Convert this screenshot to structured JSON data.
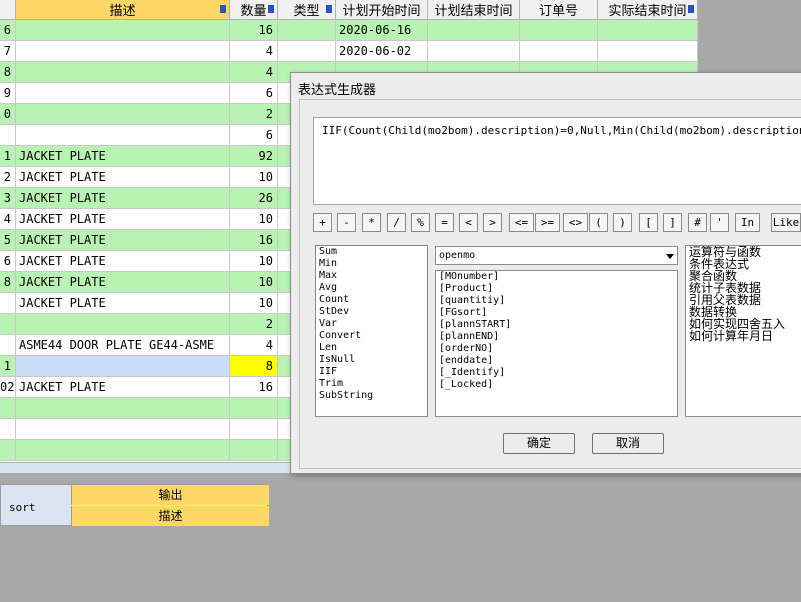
{
  "grid": {
    "headers": [
      "",
      "描述",
      "数量",
      "类型",
      "计划开始时间",
      "计划结束时间",
      "订单号",
      "实际结束时间"
    ],
    "rows": [
      {
        "id": "6",
        "desc": "",
        "qty": "16",
        "date": "2020-06-16"
      },
      {
        "id": "7",
        "desc": "",
        "qty": "4",
        "date": "2020-06-02"
      },
      {
        "id": "8",
        "desc": "",
        "qty": "4",
        "date": ""
      },
      {
        "id": "9",
        "desc": "",
        "qty": "6",
        "date": ""
      },
      {
        "id": "0",
        "desc": "",
        "qty": "2",
        "date": ""
      },
      {
        "id": "",
        "desc": "",
        "qty": "6",
        "date": ""
      },
      {
        "id": "1",
        "desc": "JACKET PLATE",
        "qty": "92",
        "date": ""
      },
      {
        "id": "2",
        "desc": "JACKET PLATE",
        "qty": "10",
        "date": ""
      },
      {
        "id": "3",
        "desc": "JACKET PLATE",
        "qty": "26",
        "date": ""
      },
      {
        "id": "4",
        "desc": "JACKET PLATE",
        "qty": "10",
        "date": ""
      },
      {
        "id": "5",
        "desc": "JACKET PLATE",
        "qty": "16",
        "date": ""
      },
      {
        "id": "6",
        "desc": "JACKET PLATE",
        "qty": "10",
        "date": ""
      },
      {
        "id": "8",
        "desc": "JACKET PLATE",
        "qty": "10",
        "date": ""
      },
      {
        "id": "",
        "desc": "JACKET PLATE",
        "qty": "10",
        "date": ""
      },
      {
        "id": "",
        "desc": "",
        "qty": "2",
        "date": ""
      },
      {
        "id": "",
        "desc": "ASME44 DOOR PLATE GE44-ASME",
        "qty": "4",
        "date": ""
      },
      {
        "id": "1",
        "desc": "",
        "qty": "8",
        "date": ""
      },
      {
        "id": "02",
        "desc": "JACKET PLATE",
        "qty": "16",
        "date": ""
      },
      {
        "id": "",
        "desc": "",
        "qty": "",
        "date": ""
      },
      {
        "id": "",
        "desc": "",
        "qty": "",
        "date": ""
      },
      {
        "id": "",
        "desc": "",
        "qty": "",
        "date": ""
      }
    ]
  },
  "subgrid": {
    "label": "sort",
    "row1": "输出",
    "row2": "描述"
  },
  "dialog": {
    "title": "表达式生成器",
    "expression": "IIF(Count(Child(mo2bom).description)=0,Null,Min(Child(mo2bom).description))",
    "operators": [
      "+",
      "-",
      "*",
      "/",
      "%",
      "=",
      "<",
      ">",
      "<=",
      ">=",
      "<>",
      "(",
      ")",
      "[",
      "]",
      "#",
      "'",
      "In",
      "Like"
    ],
    "functions": [
      "Sum",
      "Min",
      "Max",
      "Avg",
      "Count",
      "StDev",
      "Var",
      "Convert",
      "Len",
      "IsNull",
      "IIF",
      "Trim",
      "SubString"
    ],
    "table_select": "openmo",
    "fields": [
      "[MOnumber]",
      "[Product]",
      "[quantitiy]",
      "[FGsort]",
      "[plannSTART]",
      "[plannEND]",
      "[orderNO]",
      "[enddate]",
      "[_Identify]",
      "[_Locked]"
    ],
    "help_topics": [
      "运算符与函数",
      "条件表达式",
      "聚合函数",
      "统计子表数据",
      "引用父表数据",
      "数据转换",
      "如何实现四舍五入",
      "如何计算年月日"
    ],
    "ok_label": "确定",
    "cancel_label": "取消"
  },
  "colors": {
    "row_even": "#b9f3b4",
    "header_selected": "#ffd766",
    "current_qty": "#ffff00"
  }
}
